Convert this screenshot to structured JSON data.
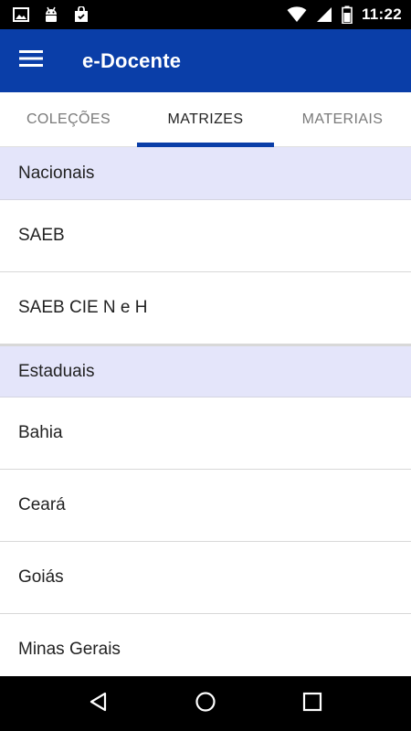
{
  "status_bar": {
    "time": "11:22",
    "left_icons": [
      "image-notification-icon",
      "android-debug-icon",
      "shopping-bag-icon"
    ],
    "right_icons": [
      "wifi-icon",
      "signal-icon",
      "battery-icon"
    ]
  },
  "app_bar": {
    "title": "e-Docente",
    "color": "#0a3ea8"
  },
  "tabs": [
    {
      "label": "COLEÇÕES",
      "active": false
    },
    {
      "label": "MATRIZES",
      "active": true
    },
    {
      "label": "MATERIAIS",
      "active": false
    }
  ],
  "sections": [
    {
      "title": "Nacionais",
      "items": [
        "SAEB",
        "SAEB CIE N e H"
      ]
    },
    {
      "title": "Estaduais",
      "items": [
        "Bahia",
        "Ceará",
        "Goiás",
        "Minas Gerais"
      ]
    }
  ],
  "nav_bar": {
    "buttons": [
      "back-icon",
      "home-icon",
      "recents-icon"
    ]
  }
}
